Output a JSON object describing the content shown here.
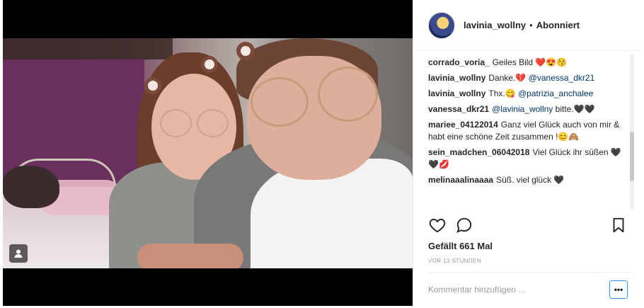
{
  "post": {
    "username": "lavinia_wollny",
    "separator": "•",
    "follow_status": "Abonniert"
  },
  "comments": [
    {
      "user": "corrado_voria_",
      "parts": [
        {
          "text": "Geiles Bild ❤️😍😚"
        }
      ]
    },
    {
      "user": "lavinia_wollny",
      "parts": [
        {
          "text": "Danke.💔 "
        },
        {
          "text": "@vanessa_dkr21",
          "mention": true
        }
      ]
    },
    {
      "user": "lavinia_wollny",
      "parts": [
        {
          "text": "Thx.😋 "
        },
        {
          "text": "@patrizia_anchalee",
          "mention": true
        }
      ]
    },
    {
      "user": "vanessa_dkr21",
      "parts": [
        {
          "text": "@lavinia_wollny",
          "mention": true
        },
        {
          "text": " bitte.🖤🖤"
        }
      ]
    },
    {
      "user": "mariee_04122014",
      "parts": [
        {
          "text": "Ganz viel Glück auch von mir & habt eine schöne Zeit zusammen !😊🙈"
        }
      ]
    },
    {
      "user": "sein_madchen_06042018",
      "parts": [
        {
          "text": "Viel Glück ihr süßen 🖤🖤💋"
        }
      ]
    },
    {
      "user": "melinaaalinaaaa",
      "parts": [
        {
          "text": "Süß. viel glück 🖤"
        }
      ]
    }
  ],
  "actions": {
    "like_icon": "heart-icon",
    "comment_icon": "speech-bubble-icon",
    "save_icon": "bookmark-icon"
  },
  "likes_text": "Gefällt 661 Mal",
  "timestamp": "VOR 13 STUNDEN",
  "comment_input": {
    "placeholder": "Kommentar hinzufügen ..."
  },
  "more_label": "•••",
  "colors": {
    "mention": "#003569",
    "text": "#262626",
    "muted": "#999999",
    "accent": "#3897f0"
  }
}
